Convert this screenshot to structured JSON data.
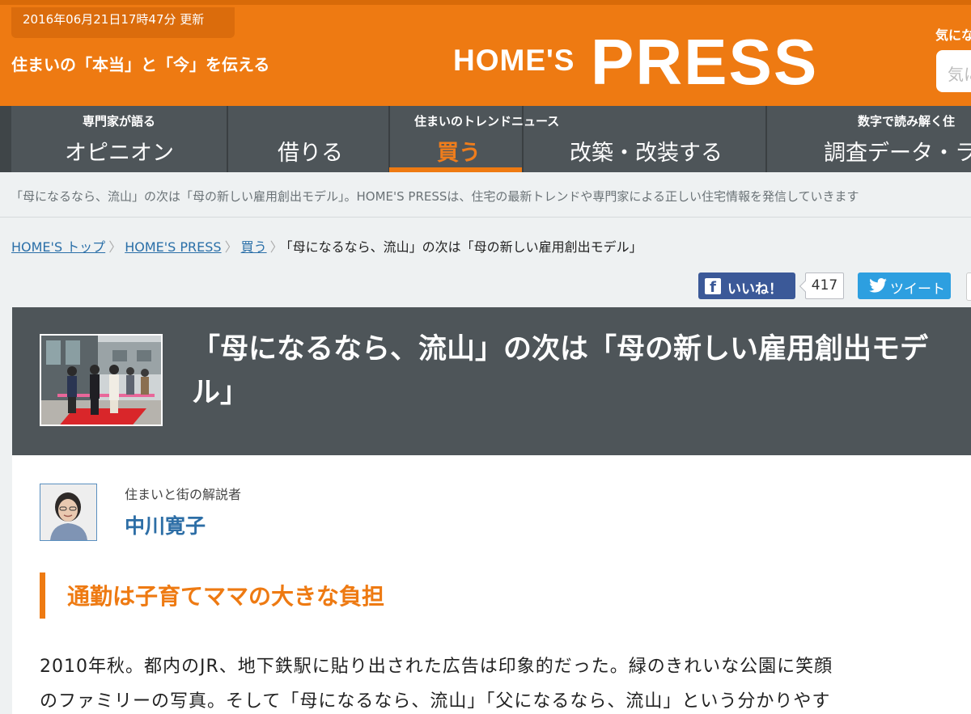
{
  "header": {
    "updated": "2016年06月21日17時47分 更新",
    "tagline": "住まいの「本当」と「今」を伝える",
    "logo_small": "HOME'S",
    "logo_big": "PRESS",
    "right_label": "気にな",
    "search_placeholder": "気に"
  },
  "nav": {
    "items": [
      {
        "caption": "専門家が語る",
        "label": "オピニオン"
      },
      {
        "caption": "",
        "label": "借りる"
      },
      {
        "caption": "住まいのトレンドニュース",
        "label": "買う"
      },
      {
        "caption": "",
        "label": "改築・改装する"
      },
      {
        "caption": "数字で読み解く住",
        "label": "調査データ・ラ"
      }
    ],
    "active": "買う"
  },
  "description": "「母になるなら、流山」の次は「母の新しい雇用創出モデル」。HOME'S PRESSは、住宅の最新トレンドや専門家による正しい住宅情報を発信していきます",
  "breadcrumb": {
    "items": [
      "HOME'S トップ",
      "HOME'S PRESS",
      "買う"
    ],
    "current": "「母になるなら、流山」の次は「母の新しい雇用創出モデル」"
  },
  "social": {
    "facebook_label": "いいね！",
    "facebook_count": "417",
    "twitter_label": "ツイート"
  },
  "article": {
    "title": "「母になるなら、流山」の次は「母の新しい雇用創出モデル」",
    "author_role": "住まいと街の解説者",
    "author_name": "中川寛子",
    "heading": "通勤は子育てママの大きな負担",
    "body_line1": "2010年秋。都内のJR、地下鉄駅に貼り出された広告は印象的だった。緑のきれいな公園に笑顔",
    "body_line2": "のファミリーの写真。そして「母になるなら、流山」「父になるなら、流山」という分かりやす"
  },
  "colors": {
    "brand_orange": "#ee7a12",
    "nav_dark": "#4e5559",
    "link_blue": "#2a6fa8",
    "facebook": "#3b5998",
    "twitter": "#2d9fe0"
  }
}
